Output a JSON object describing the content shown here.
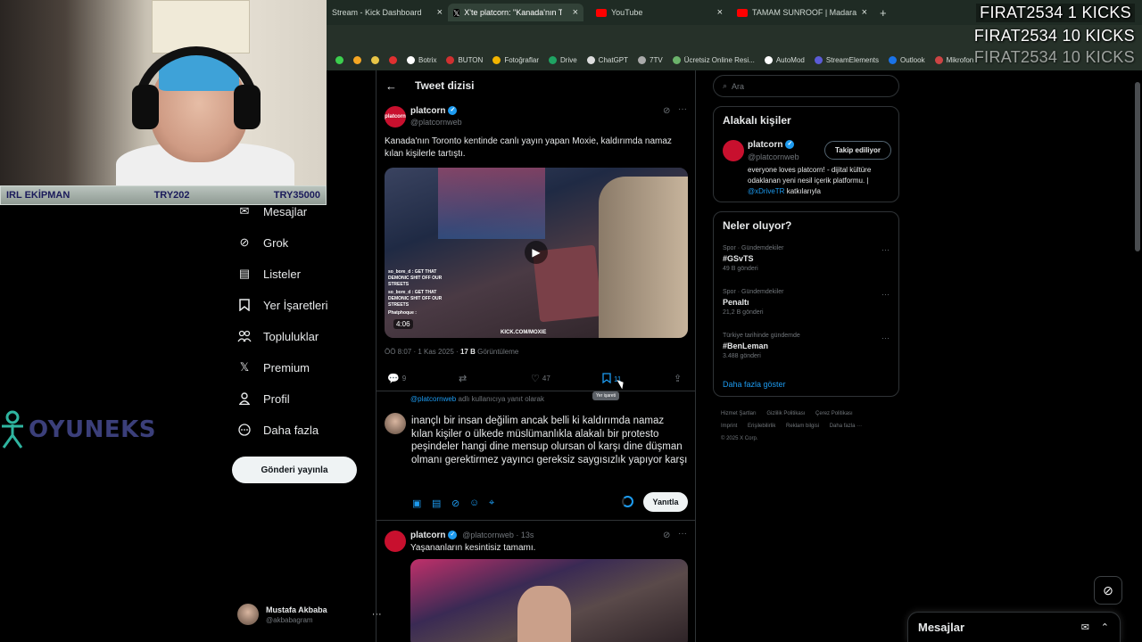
{
  "browser": {
    "tabs": [
      {
        "label": "Stream - Kick Dashboard",
        "color": "#3ccf4e"
      },
      {
        "label": "X'te platcorn: \"Kanada'nın Toron",
        "color": "#ffffff"
      },
      {
        "label": "YouTube",
        "color": "#ff0000"
      },
      {
        "label": "TAMAM SUNROOF | Madara O",
        "color": "#ff0000"
      }
    ],
    "new_tab": "+",
    "close": "×",
    "bookmarks": [
      "Botrix",
      "BUTON",
      "Fotoğraflar",
      "Drive",
      "ChatGPT",
      "7TV",
      "Ücretsiz Online Resi...",
      "AutoMod",
      "StreamElements",
      "Outlook",
      "Mikrofon"
    ]
  },
  "overlay": {
    "kicks": [
      "FIRAT2534  1 KICKS",
      "FIRAT2534  10 KICKS",
      "FIRAT2534  10 KICKS"
    ],
    "irl_bar": {
      "left": "IRL EKİPMAN",
      "mid": "TRY202",
      "right": "TRY35000"
    },
    "sponsor": "OYUNEKS"
  },
  "nav": {
    "items": [
      {
        "label": "Mesajlar",
        "icon": "✉"
      },
      {
        "label": "Grok",
        "icon": "⊘"
      },
      {
        "label": "Listeler",
        "icon": "▤"
      },
      {
        "label": "Yer İşaretleri",
        "icon": "🔖"
      },
      {
        "label": "Topluluklar",
        "icon": "👥"
      },
      {
        "label": "Premium",
        "icon": "𝕏"
      },
      {
        "label": "Profil",
        "icon": "👤"
      },
      {
        "label": "Daha fazla",
        "icon": "⋯"
      }
    ],
    "post_button": "Gönderi yayınla",
    "profile": {
      "name": "Mustafa Akbaba",
      "handle": "@akbabagram"
    }
  },
  "thread": {
    "back": "←",
    "title": "Tweet dizisi",
    "tweet": {
      "avatar_text": "platcorn",
      "name": "platcorn",
      "handle": "@platcornweb",
      "text": "Kanada'nın Toronto kentinde canlı yayın yapan Moxie, kaldırımda namaz kılan kişilerle tartıştı.",
      "video": {
        "duration": "4:06",
        "watermark": "KICK.COM/MOXIE",
        "chat1": "so_bore_d : GET THAT DEMONIC SHIT OFF OUR STREETS",
        "chat2": "so_bore_d : GET THAT DEMONIC SHIT OFF OUR STREETS",
        "chat3": "Phatphoque :"
      },
      "time": "ÖÖ 8:07 · 1 Kas 2025 ·",
      "views_count": "17 B",
      "views_label": "Görüntüleme",
      "replies": "9",
      "likes": "47",
      "bookmarks": "11",
      "tooltip": "Yer işareti"
    },
    "reply": {
      "to_handle": "@platcornweb",
      "to_suffix": "adlı kullanıcıya yanıt olarak",
      "draft": "inançlı bir insan değilim ancak belli ki kaldırımda namaz kılan kişiler o ülkede müslümanlıkla alakalı bir protesto peşindeler hangi dine mensup olursan ol karşı dine düşman olmanı gerektirmez yayıncı gereksiz saygısızlık yapıyor karşı",
      "button": "Yanıtla"
    },
    "next_tweet": {
      "name": "platcorn",
      "handle": "@platcornweb · 13s",
      "text": "Yaşananların kesintisiz tamamı."
    }
  },
  "sidebar": {
    "search_placeholder": "Ara",
    "related": {
      "title": "Alakalı kişiler",
      "name": "platcorn",
      "handle": "@platcornweb",
      "follow": "Takip ediliyor",
      "bio": "everyone loves platcorn! - dijital kültüre odaklanan yeni nesil içerik platformu. |",
      "bio_link": "@xDriveTR",
      "bio_tail": "katkılarıyla"
    },
    "trends": {
      "title": "Neler oluyor?",
      "items": [
        {
          "category": "Spor · Gündemdekiler",
          "name": "#GSvTS",
          "count": "49 B gönderi"
        },
        {
          "category": "Spor · Gündemdekiler",
          "name": "Penaltı",
          "count": "21,2 B gönderi"
        },
        {
          "category": "Türkiye tarihinde gündemde",
          "name": "#BenLeman",
          "count": "3.488 gönderi"
        }
      ],
      "more": "Daha fazla göster"
    },
    "footer": [
      "Hizmet Şartları",
      "Gizlilik Politikası",
      "Çerez Politikası",
      "Imprint",
      "Erişilebilirlik",
      "Reklam bilgisi",
      "Daha fazla ···",
      "© 2025 X Corp."
    ]
  },
  "messages_bar": {
    "label": "Mesajlar"
  }
}
